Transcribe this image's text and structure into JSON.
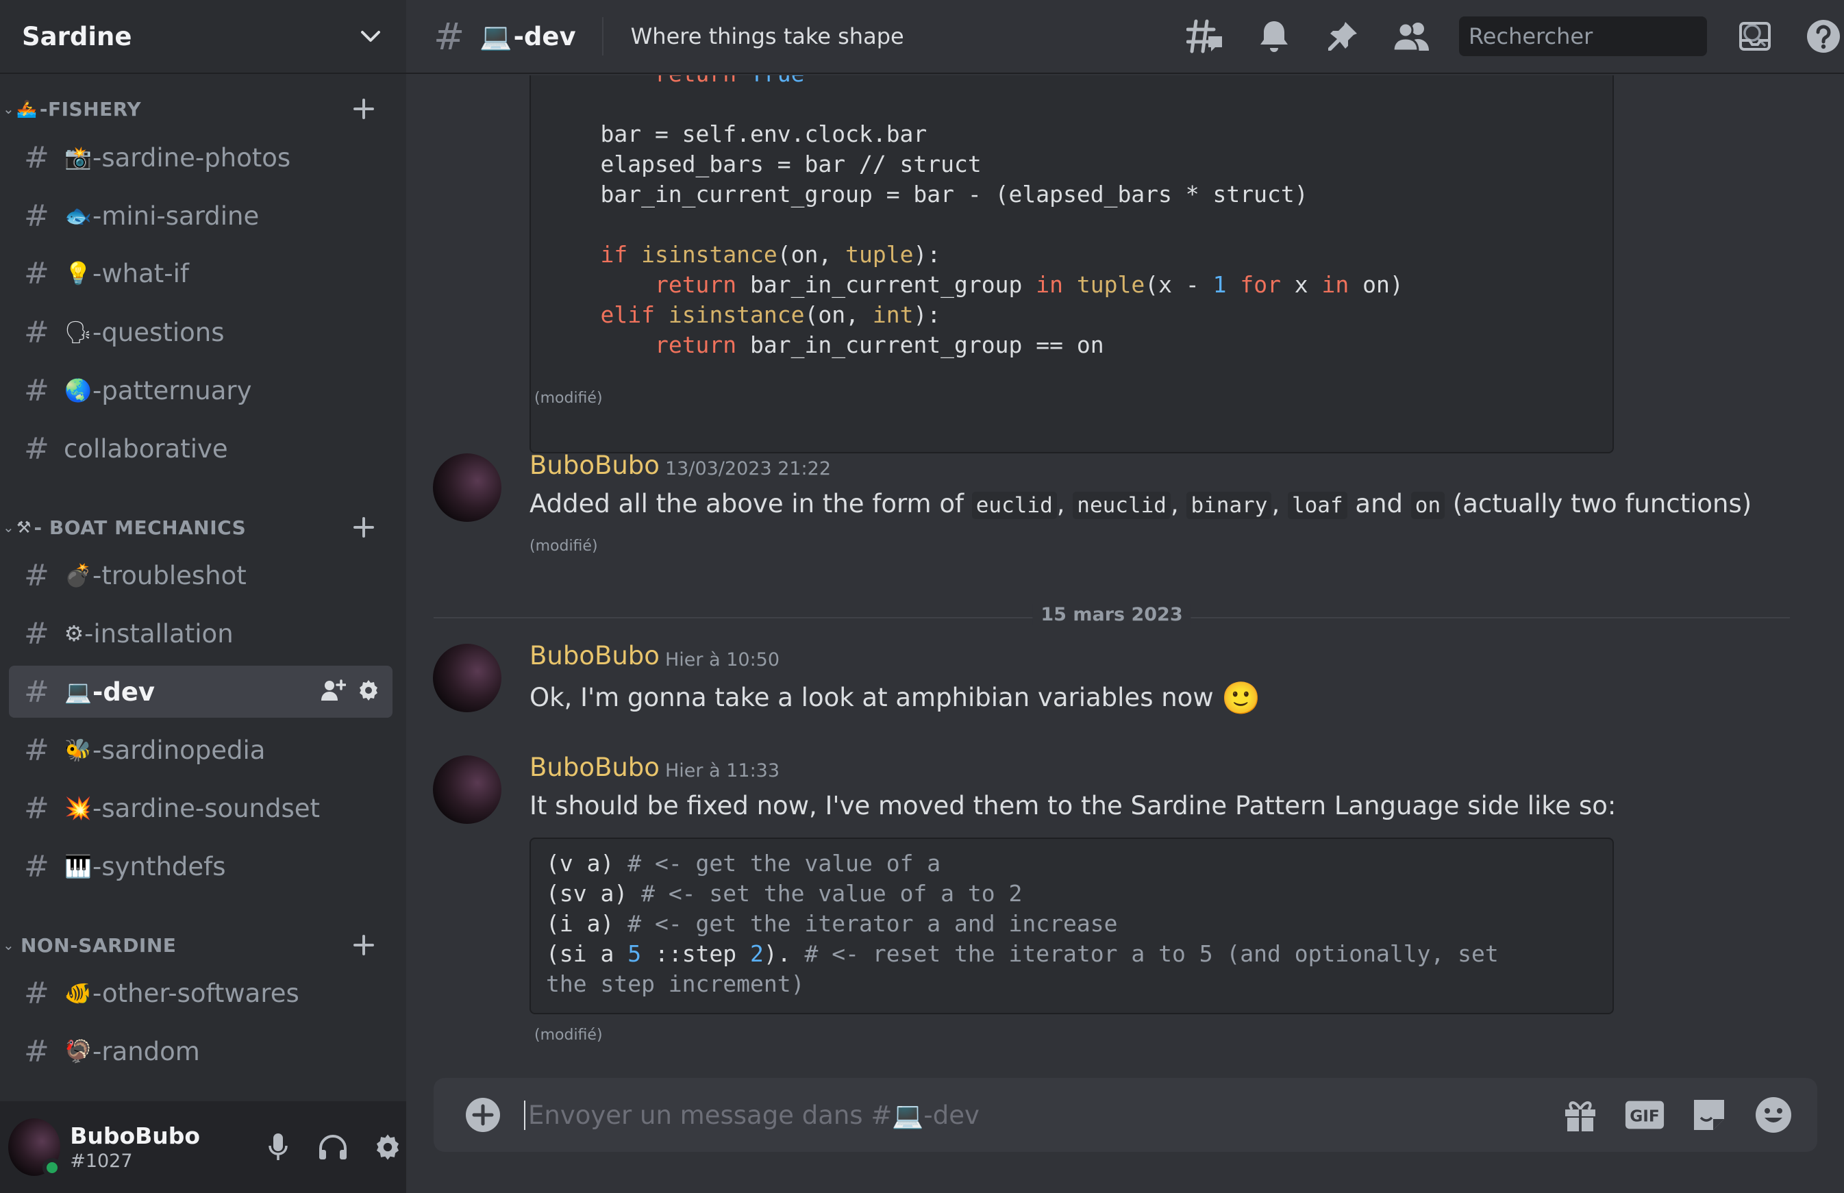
{
  "server": {
    "name": "Sardine"
  },
  "categories": [
    {
      "label": "-FISHERY",
      "emoji": "🚣"
    },
    {
      "label": "- BOAT MECHANICS",
      "emoji": "⚒"
    },
    {
      "label": "NON-SARDINE",
      "emoji": ""
    }
  ],
  "channels": [
    {
      "emoji": "📸",
      "label": "-sardine-photos"
    },
    {
      "emoji": "🐟",
      "label": "-mini-sardine"
    },
    {
      "emoji": "💡",
      "label": "-what-if"
    },
    {
      "emoji": "🗣",
      "label": "-questions"
    },
    {
      "emoji": "🌏",
      "label": "-patternuary"
    },
    {
      "emoji": "",
      "label": "collaborative"
    },
    {
      "emoji": "💣",
      "label": "-troubleshot"
    },
    {
      "emoji": "⚙",
      "label": "-installation"
    },
    {
      "emoji": "💻",
      "label": "-dev"
    },
    {
      "emoji": "🐝",
      "label": "-sardinopedia"
    },
    {
      "emoji": "💥",
      "label": "-sardine-soundset"
    },
    {
      "emoji": "🎹",
      "label": "-synthdefs"
    },
    {
      "emoji": "🐠",
      "label": "-other-softwares"
    },
    {
      "emoji": "🦃",
      "label": "-random"
    }
  ],
  "user": {
    "name": "BuboBubo",
    "tag": "#1027"
  },
  "header": {
    "emoji": "💻",
    "channel": "-dev",
    "topic": "Where things take shape",
    "search_placeholder": "Rechercher"
  },
  "code_block_1": {
    "lines": [
      "    return True",
      "",
      "bar = self.env.clock.bar",
      "elapsed_bars = bar // struct",
      "bar_in_current_group = bar - (elapsed_bars * struct)",
      "",
      "if isinstance(on, tuple):",
      "    return bar_in_current_group in tuple(x - 1 for x in on)",
      "elif isinstance(on, int):",
      "    return bar_in_current_group == on"
    ]
  },
  "edited_label": "(modifié)",
  "messages": [
    {
      "author": "BuboBubo",
      "time": "13/03/2023 21:22",
      "text_parts": [
        "Added all the above in the form of ",
        "euclid",
        ", ",
        "neuclid",
        ", ",
        "binary",
        ", ",
        "loaf",
        " and ",
        "on",
        " (actually two functions)"
      ]
    },
    {
      "author": "BuboBubo",
      "time": "Hier à 10:50",
      "text": "Ok, I'm gonna take a look at amphibian variables now",
      "emoji": "🙂"
    },
    {
      "author": "BuboBubo",
      "time": "Hier à 11:33",
      "text": "It should be fixed now, I've moved them to the Sardine Pattern Language side like so:"
    }
  ],
  "date_divider": "15 mars 2023",
  "code_block_2": {
    "lines": [
      "(v a) # <- get the value of a",
      "(sv a) # <- set the value of a to 2",
      "(i a) # <- get the iterator a and increase",
      "(si a 5 ::step 2). # <- reset the iterator a to 5 (and optionally, set",
      "the step increment)"
    ]
  },
  "composer": {
    "placeholder": "Envoyer un message dans #💻-dev"
  },
  "colors": {
    "author": "#e9c56c",
    "background": "#313338",
    "sidebar": "#2b2d31",
    "status_online": "#23a55a"
  }
}
